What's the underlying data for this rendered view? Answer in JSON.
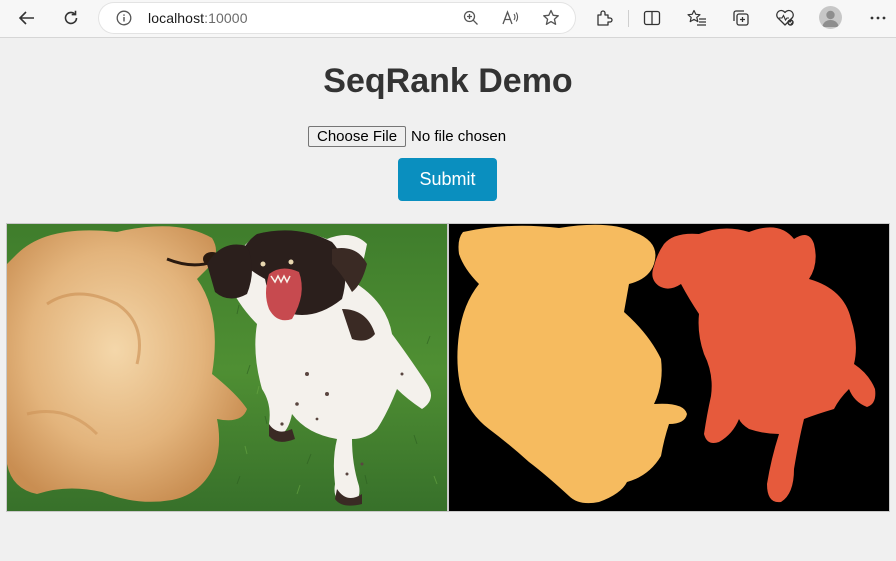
{
  "browser": {
    "url_host": "localhost",
    "url_port": ":10000",
    "icons": [
      "back-icon",
      "refresh-icon",
      "info-icon",
      "zoom-icon",
      "read-aloud-icon",
      "favorite-star-icon",
      "extensions-icon",
      "split-screen-icon",
      "favorites-icon",
      "collections-icon",
      "browser-essentials-icon",
      "profile-icon",
      "more-icon"
    ]
  },
  "page": {
    "title": "SeqRank Demo",
    "choose_file_label": "Choose File",
    "file_status": "No file chosen",
    "submit_label": "Submit"
  },
  "images": {
    "input": "photo of a golden retriever and a springer spaniel playing on grass",
    "output": "segmentation mask: yellow and orange dog silhouettes on black background",
    "mask_colors": {
      "background": "#000000",
      "dog_left": "#f6bb5f",
      "dog_right": "#e65a3c"
    }
  }
}
